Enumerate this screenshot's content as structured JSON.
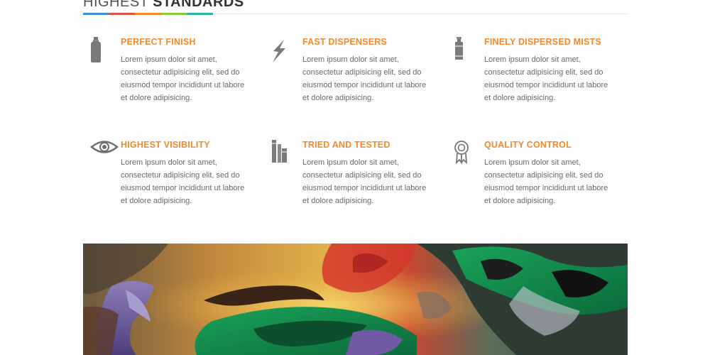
{
  "heading": {
    "light": "HIGHEST",
    "bold": "STANDARDS"
  },
  "colors": {
    "accent": "#ef8a2e",
    "heading_bar": [
      "#3b8fd6",
      "#d9534f",
      "#ef8a2e",
      "#8cc63f",
      "#2bb5a6"
    ]
  },
  "features": [
    {
      "icon": "spray-can-icon",
      "title": "PERFECT FINISH",
      "lines": [
        "Lorem ipsum dolor sit amet,",
        "consectetur adipisicing elit, sed do",
        "eiusmod tempor incididunt ut labore",
        "et dolore adipisicing."
      ]
    },
    {
      "icon": "lightning-bolt-icon",
      "title": "FAST DISPENSERS",
      "lines": [
        "Lorem ipsum dolor sit amet,",
        "consectetur adipisicing elit, sed do",
        "eiusmod tempor incididunt ut labore",
        "et dolore adipisicing."
      ]
    },
    {
      "icon": "spray-nozzle-can-icon",
      "title": "FINELY DISPERSED MISTS",
      "lines": [
        "Lorem ipsum dolor sit amet,",
        "consectetur adipisicing elit, sed do",
        "eiusmod tempor incididunt ut labore",
        "et dolore adipisicing."
      ]
    },
    {
      "icon": "eye-icon",
      "title": "HIGHEST VISIBILITY",
      "lines": [
        "Lorem ipsum dolor sit amet,",
        "consectetur adipisicing elit, sed do",
        "eiusmod tempor incididunt ut labore",
        "et dolore adipisicing."
      ]
    },
    {
      "icon": "spray-cans-set-icon",
      "title": "TRIED AND TESTED",
      "lines": [
        "Lorem ipsum dolor sit amet,",
        "consectetur adipisicing elit, sed do",
        "eiusmod tempor incididunt ut labore",
        "et dolore adipisicing."
      ]
    },
    {
      "icon": "award-ribbon-icon",
      "title": "QUALITY CONTROL",
      "lines": [
        "Lorem ipsum dolor sit amet,",
        "consectetur adipisicing elit, sed do",
        "eiusmod tempor incididunt ut labore",
        "et dolore adipisicing."
      ]
    }
  ],
  "image": {
    "subject": "graffiti-mural"
  }
}
